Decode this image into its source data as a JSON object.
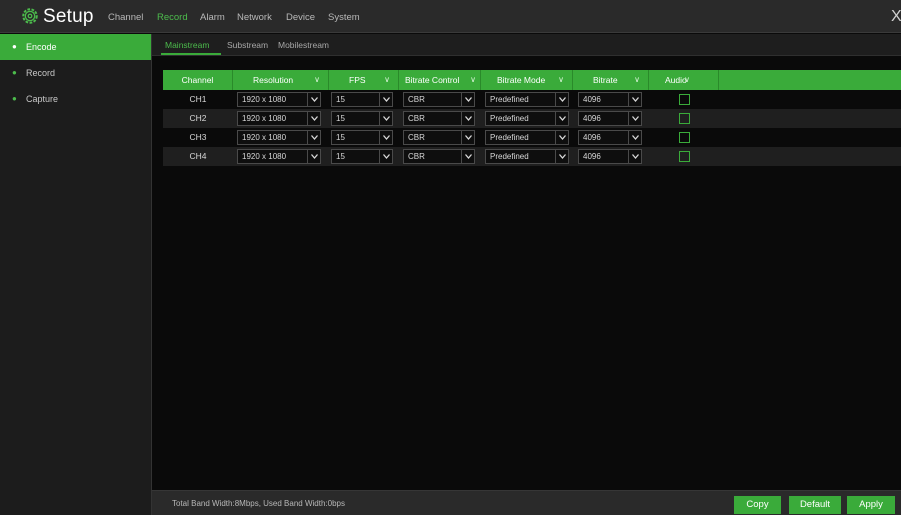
{
  "app": {
    "title": "Setup",
    "close_label": "X"
  },
  "menu": [
    {
      "label": "Channel",
      "active": false
    },
    {
      "label": "Record",
      "active": true
    },
    {
      "label": "Alarm",
      "active": false
    },
    {
      "label": "Network",
      "active": false
    },
    {
      "label": "Device",
      "active": false
    },
    {
      "label": "System",
      "active": false
    }
  ],
  "sidebar": {
    "items": [
      {
        "label": "Encode",
        "active": true
      },
      {
        "label": "Record",
        "active": false
      },
      {
        "label": "Capture",
        "active": false
      }
    ]
  },
  "subtabs": [
    {
      "label": "Mainstream",
      "active": true
    },
    {
      "label": "Substream",
      "active": false
    },
    {
      "label": "Mobilestream",
      "active": false
    }
  ],
  "table": {
    "headers": {
      "channel": "Channel",
      "resolution": "Resolution",
      "fps": "FPS",
      "bitrate_control": "Bitrate Control",
      "bitrate_mode": "Bitrate Mode",
      "bitrate": "Bitrate",
      "audio": "Audio"
    },
    "rows": [
      {
        "channel": "CH1",
        "resolution": "1920 x 1080",
        "fps": "15",
        "bitrate_control": "CBR",
        "bitrate_mode": "Predefined",
        "bitrate": "4096",
        "audio": false
      },
      {
        "channel": "CH2",
        "resolution": "1920 x 1080",
        "fps": "15",
        "bitrate_control": "CBR",
        "bitrate_mode": "Predefined",
        "bitrate": "4096",
        "audio": false
      },
      {
        "channel": "CH3",
        "resolution": "1920 x 1080",
        "fps": "15",
        "bitrate_control": "CBR",
        "bitrate_mode": "Predefined",
        "bitrate": "4096",
        "audio": false
      },
      {
        "channel": "CH4",
        "resolution": "1920 x 1080",
        "fps": "15",
        "bitrate_control": "CBR",
        "bitrate_mode": "Predefined",
        "bitrate": "4096",
        "audio": false
      }
    ]
  },
  "footer": {
    "bandwidth_text": "Total Band Width:8Mbps, Used Band Width:0bps",
    "copy_label": "Copy",
    "default_label": "Default",
    "apply_label": "Apply"
  },
  "colors": {
    "accent": "#3aab3a",
    "background": "#0a0a0a",
    "bar": "#2a2a2a"
  }
}
